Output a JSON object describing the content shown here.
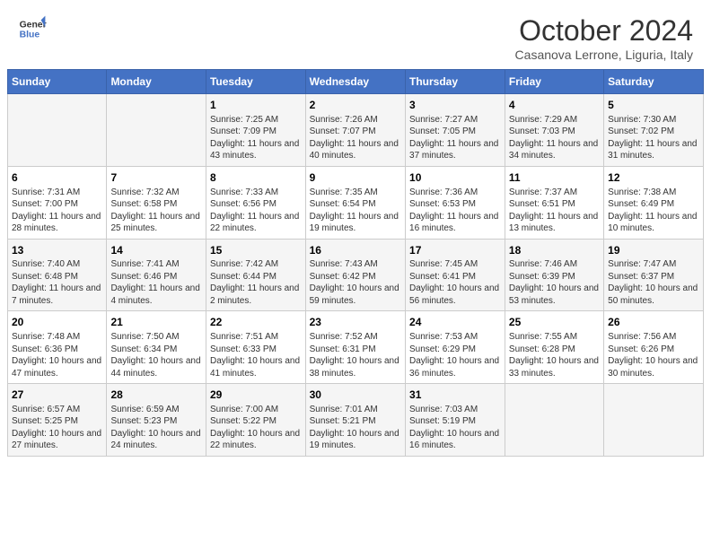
{
  "header": {
    "logo_line1": "General",
    "logo_line2": "Blue",
    "month": "October 2024",
    "location": "Casanova Lerrone, Liguria, Italy"
  },
  "days_of_week": [
    "Sunday",
    "Monday",
    "Tuesday",
    "Wednesday",
    "Thursday",
    "Friday",
    "Saturday"
  ],
  "weeks": [
    [
      {
        "day": "",
        "info": ""
      },
      {
        "day": "",
        "info": ""
      },
      {
        "day": "1",
        "info": "Sunrise: 7:25 AM\nSunset: 7:09 PM\nDaylight: 11 hours and 43 minutes."
      },
      {
        "day": "2",
        "info": "Sunrise: 7:26 AM\nSunset: 7:07 PM\nDaylight: 11 hours and 40 minutes."
      },
      {
        "day": "3",
        "info": "Sunrise: 7:27 AM\nSunset: 7:05 PM\nDaylight: 11 hours and 37 minutes."
      },
      {
        "day": "4",
        "info": "Sunrise: 7:29 AM\nSunset: 7:03 PM\nDaylight: 11 hours and 34 minutes."
      },
      {
        "day": "5",
        "info": "Sunrise: 7:30 AM\nSunset: 7:02 PM\nDaylight: 11 hours and 31 minutes."
      }
    ],
    [
      {
        "day": "6",
        "info": "Sunrise: 7:31 AM\nSunset: 7:00 PM\nDaylight: 11 hours and 28 minutes."
      },
      {
        "day": "7",
        "info": "Sunrise: 7:32 AM\nSunset: 6:58 PM\nDaylight: 11 hours and 25 minutes."
      },
      {
        "day": "8",
        "info": "Sunrise: 7:33 AM\nSunset: 6:56 PM\nDaylight: 11 hours and 22 minutes."
      },
      {
        "day": "9",
        "info": "Sunrise: 7:35 AM\nSunset: 6:54 PM\nDaylight: 11 hours and 19 minutes."
      },
      {
        "day": "10",
        "info": "Sunrise: 7:36 AM\nSunset: 6:53 PM\nDaylight: 11 hours and 16 minutes."
      },
      {
        "day": "11",
        "info": "Sunrise: 7:37 AM\nSunset: 6:51 PM\nDaylight: 11 hours and 13 minutes."
      },
      {
        "day": "12",
        "info": "Sunrise: 7:38 AM\nSunset: 6:49 PM\nDaylight: 11 hours and 10 minutes."
      }
    ],
    [
      {
        "day": "13",
        "info": "Sunrise: 7:40 AM\nSunset: 6:48 PM\nDaylight: 11 hours and 7 minutes."
      },
      {
        "day": "14",
        "info": "Sunrise: 7:41 AM\nSunset: 6:46 PM\nDaylight: 11 hours and 4 minutes."
      },
      {
        "day": "15",
        "info": "Sunrise: 7:42 AM\nSunset: 6:44 PM\nDaylight: 11 hours and 2 minutes."
      },
      {
        "day": "16",
        "info": "Sunrise: 7:43 AM\nSunset: 6:42 PM\nDaylight: 10 hours and 59 minutes."
      },
      {
        "day": "17",
        "info": "Sunrise: 7:45 AM\nSunset: 6:41 PM\nDaylight: 10 hours and 56 minutes."
      },
      {
        "day": "18",
        "info": "Sunrise: 7:46 AM\nSunset: 6:39 PM\nDaylight: 10 hours and 53 minutes."
      },
      {
        "day": "19",
        "info": "Sunrise: 7:47 AM\nSunset: 6:37 PM\nDaylight: 10 hours and 50 minutes."
      }
    ],
    [
      {
        "day": "20",
        "info": "Sunrise: 7:48 AM\nSunset: 6:36 PM\nDaylight: 10 hours and 47 minutes."
      },
      {
        "day": "21",
        "info": "Sunrise: 7:50 AM\nSunset: 6:34 PM\nDaylight: 10 hours and 44 minutes."
      },
      {
        "day": "22",
        "info": "Sunrise: 7:51 AM\nSunset: 6:33 PM\nDaylight: 10 hours and 41 minutes."
      },
      {
        "day": "23",
        "info": "Sunrise: 7:52 AM\nSunset: 6:31 PM\nDaylight: 10 hours and 38 minutes."
      },
      {
        "day": "24",
        "info": "Sunrise: 7:53 AM\nSunset: 6:29 PM\nDaylight: 10 hours and 36 minutes."
      },
      {
        "day": "25",
        "info": "Sunrise: 7:55 AM\nSunset: 6:28 PM\nDaylight: 10 hours and 33 minutes."
      },
      {
        "day": "26",
        "info": "Sunrise: 7:56 AM\nSunset: 6:26 PM\nDaylight: 10 hours and 30 minutes."
      }
    ],
    [
      {
        "day": "27",
        "info": "Sunrise: 6:57 AM\nSunset: 5:25 PM\nDaylight: 10 hours and 27 minutes."
      },
      {
        "day": "28",
        "info": "Sunrise: 6:59 AM\nSunset: 5:23 PM\nDaylight: 10 hours and 24 minutes."
      },
      {
        "day": "29",
        "info": "Sunrise: 7:00 AM\nSunset: 5:22 PM\nDaylight: 10 hours and 22 minutes."
      },
      {
        "day": "30",
        "info": "Sunrise: 7:01 AM\nSunset: 5:21 PM\nDaylight: 10 hours and 19 minutes."
      },
      {
        "day": "31",
        "info": "Sunrise: 7:03 AM\nSunset: 5:19 PM\nDaylight: 10 hours and 16 minutes."
      },
      {
        "day": "",
        "info": ""
      },
      {
        "day": "",
        "info": ""
      }
    ]
  ]
}
